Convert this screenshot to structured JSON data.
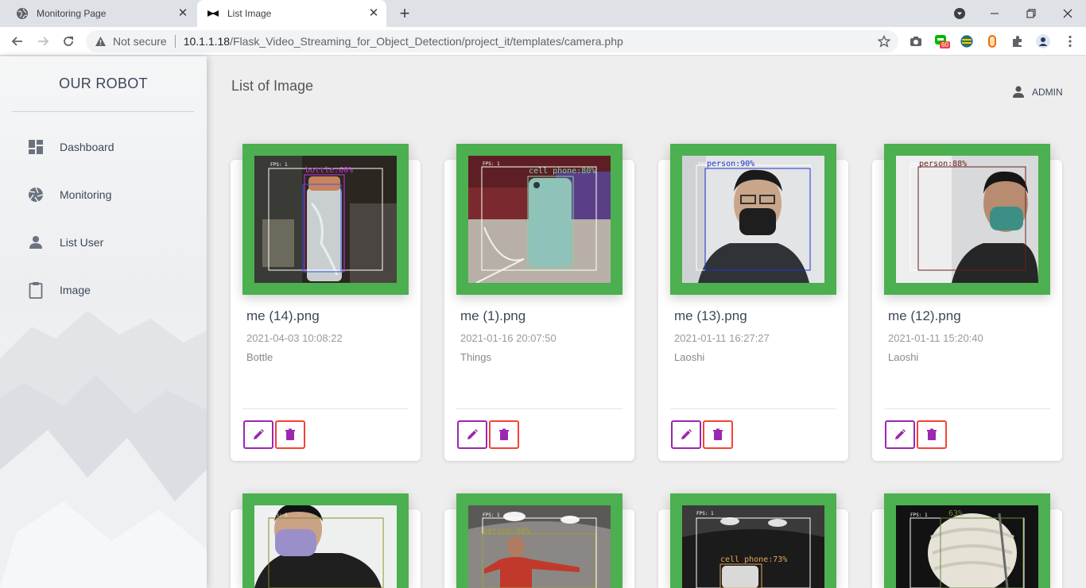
{
  "browser": {
    "tabs": [
      {
        "title": "Monitoring Page",
        "active": false
      },
      {
        "title": "List Image",
        "active": true
      }
    ],
    "address": {
      "security": "Not secure",
      "host": "10.1.1.18",
      "path": "/Flask_Video_Streaming_for_Object_Detection/project_it/templates/camera.php"
    },
    "extension_badge": "60"
  },
  "sidebar": {
    "brand": "OUR ROBOT",
    "items": [
      {
        "label": "Dashboard",
        "icon": "dashboard-icon"
      },
      {
        "label": "Monitoring",
        "icon": "camera-shutter-icon"
      },
      {
        "label": "List User",
        "icon": "person-icon"
      },
      {
        "label": "Image",
        "icon": "clipboard-icon"
      }
    ]
  },
  "header": {
    "title": "List of Image",
    "user": "ADMIN"
  },
  "cards": [
    {
      "name": "me (14).png",
      "date": "2021-04-03 10:08:22",
      "category": "Bottle",
      "detection": "bottle:60%",
      "fps": "FPS: 1"
    },
    {
      "name": "me (1).png",
      "date": "2021-01-16 20:07:50",
      "category": "Things",
      "detection": "cell phone:80%",
      "fps": "FPS: 1"
    },
    {
      "name": "me (13).png",
      "date": "2021-01-11 16:27:27",
      "category": "Laoshi",
      "detection": "person:90%",
      "fps": "FPS: 1"
    },
    {
      "name": "me (12).png",
      "date": "2021-01-11 15:20:40",
      "category": "Laoshi",
      "detection": "person:88%",
      "fps": "FPS: 1"
    },
    {
      "name": "",
      "date": "",
      "category": "",
      "detection": "",
      "fps": "FPS: 1"
    },
    {
      "name": "",
      "date": "",
      "category": "",
      "detection": "person:86%",
      "fps": "FPS: 1"
    },
    {
      "name": "",
      "date": "",
      "category": "",
      "detection": "cell phone:73%",
      "fps": "FPS: 1"
    },
    {
      "name": "",
      "date": "",
      "category": "",
      "detection": "63%",
      "fps": "FPS: 1"
    }
  ],
  "colors": {
    "thumb_frame": "#4caf50",
    "edit": "#9c27b0",
    "delete": "#f44336"
  }
}
